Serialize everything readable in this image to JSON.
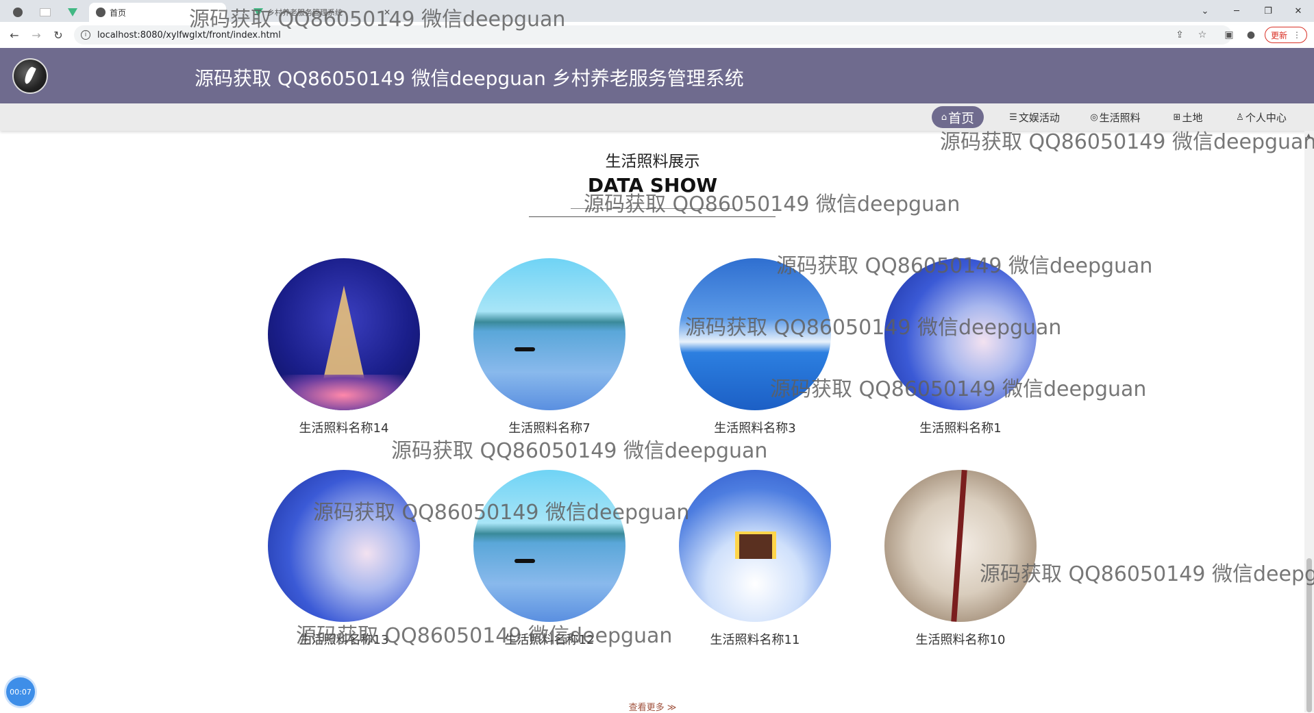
{
  "browser": {
    "tabs": [
      {
        "title": "首页"
      },
      {
        "title": "乡村养老服务管理系统"
      }
    ],
    "url": "localhost:8080/xylfwglxt/front/index.html",
    "update_label": "更新",
    "window_controls": {
      "collapse": "⌄",
      "minimize": "─",
      "restore": "❐",
      "close": "✕"
    }
  },
  "header": {
    "title": "源码获取 QQ86050149 微信deepguan 乡村养老服务管理系统"
  },
  "nav": {
    "items": [
      {
        "icon": "⌂",
        "label": "首页"
      },
      {
        "icon": "☰",
        "label": "文娱活动"
      },
      {
        "icon": "◎",
        "label": "生活照料"
      },
      {
        "icon": "⊞",
        "label": "土地"
      },
      {
        "icon": "♙",
        "label": "个人中心"
      }
    ]
  },
  "section": {
    "title_cn": "生活照料展示",
    "title_en": "DATA SHOW",
    "more_label": "查看更多 ≫"
  },
  "gallery": [
    {
      "name": "生活照料名称14",
      "image": "eiffel-tower-night"
    },
    {
      "name": "生活照料名称7",
      "image": "lake-boat"
    },
    {
      "name": "生活照料名称3",
      "image": "sea-clouds"
    },
    {
      "name": "生活照料名称1",
      "image": "sky-clouds"
    },
    {
      "name": "生活照料名称13",
      "image": "sky-clouds"
    },
    {
      "name": "生活照料名称12",
      "image": "lake-boat"
    },
    {
      "name": "生活照料名称11",
      "image": "snow-cabin"
    },
    {
      "name": "生活照料名称10",
      "image": "blossom-tree"
    }
  ],
  "recording": {
    "time": "00:07"
  },
  "watermark": {
    "text": "源码获取 QQ86050149 微信deepguan"
  },
  "colors": {
    "header_bg": "#6f6b8e",
    "nav_bg": "#ebebeb",
    "more_link": "#a0523d"
  }
}
